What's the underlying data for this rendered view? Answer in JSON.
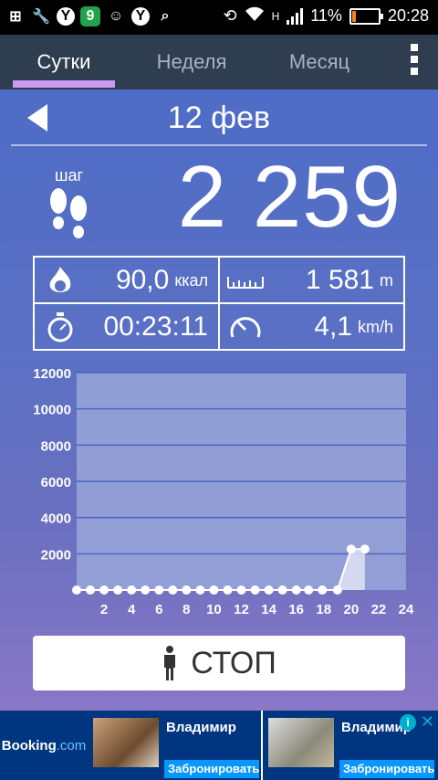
{
  "status_bar": {
    "network": "H",
    "sim": "1",
    "battery_percent": "11%",
    "time": "20:28"
  },
  "tabs": [
    {
      "label": "Сутки",
      "active": true
    },
    {
      "label": "Неделя",
      "active": false
    },
    {
      "label": "Месяц",
      "active": false
    }
  ],
  "date": "12 фев",
  "steps": {
    "label": "шаг",
    "value": "2 259"
  },
  "stats": {
    "calories": {
      "value": "90,0",
      "unit": "ккал"
    },
    "distance": {
      "value": "1 581",
      "unit": "m"
    },
    "duration": {
      "value": "00:23:11"
    },
    "speed": {
      "value": "4,1",
      "unit": "km/h"
    }
  },
  "chart_data": {
    "type": "area",
    "y_ticks": [
      "12000",
      "10000",
      "8000",
      "6000",
      "4000",
      "2000"
    ],
    "x_ticks": [
      "2",
      "4",
      "6",
      "8",
      "10",
      "12",
      "14",
      "16",
      "18",
      "20",
      "22",
      "24"
    ],
    "ylim": [
      0,
      12000
    ],
    "xlim": [
      0,
      24
    ],
    "x": [
      0,
      1,
      2,
      3,
      4,
      5,
      6,
      7,
      8,
      9,
      10,
      11,
      12,
      13,
      14,
      15,
      16,
      16.9,
      17.9,
      19,
      20,
      21
    ],
    "values": [
      0,
      0,
      0,
      0,
      0,
      0,
      0,
      0,
      0,
      0,
      0,
      0,
      0,
      0,
      0,
      0,
      0,
      0,
      0,
      0,
      2259,
      2259
    ],
    "colors": {
      "area": "#dfe3f5",
      "line": "#ffffff",
      "grid": "#4a66c2",
      "bg": "#9aa6d9"
    }
  },
  "stop_button": {
    "label": "СТОП"
  },
  "ad": {
    "brand": "Booking",
    "brand_suffix": ".com",
    "cards": [
      {
        "title": "Владимир",
        "cta": "Забронировать"
      },
      {
        "title": "Владимир",
        "cta": "Забронировать"
      }
    ]
  }
}
